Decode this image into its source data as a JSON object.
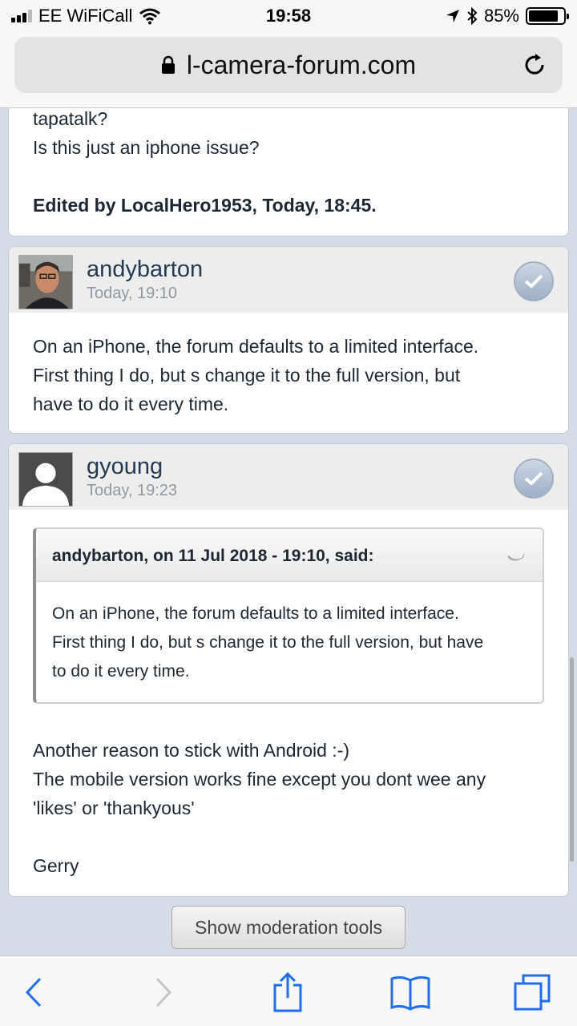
{
  "status_bar": {
    "carrier": "EE WiFiCall",
    "time": "19:58",
    "battery": "85%",
    "battery_level": 0.85
  },
  "browser": {
    "url": "l-camera-forum.com"
  },
  "posts": [
    {
      "tail_text_1": "tapatalk?",
      "tail_text_2": "Is this just an iphone issue?",
      "edited": "Edited by LocalHero1953, Today, 18:45."
    },
    {
      "username": "andybarton",
      "time": "Today, 19:10",
      "body": [
        "On an iPhone, the forum defaults to a limited interface.",
        "First thing I do, but s change it to the full version, but",
        "have to do it every time."
      ]
    },
    {
      "username": "gyoung",
      "time": "Today, 19:23",
      "quote_header": "andybarton, on 11 Jul 2018 - 19:10, said:",
      "quote_body": [
        "On an iPhone, the forum defaults to a limited interface.",
        "First thing I do, but s change it to the full version, but have",
        "to do it every time."
      ],
      "body": [
        "Another reason to stick with Android :-)",
        "The mobile version works fine except you dont wee any",
        "'likes' or 'thankyous'"
      ],
      "signature": "Gerry"
    }
  ],
  "moderation_button": "Show moderation tools",
  "icons": {
    "back": "back-icon",
    "forward": "forward-icon",
    "share": "share-icon",
    "bookmarks": "bookmarks-icon",
    "tabs": "tabs-icon"
  }
}
